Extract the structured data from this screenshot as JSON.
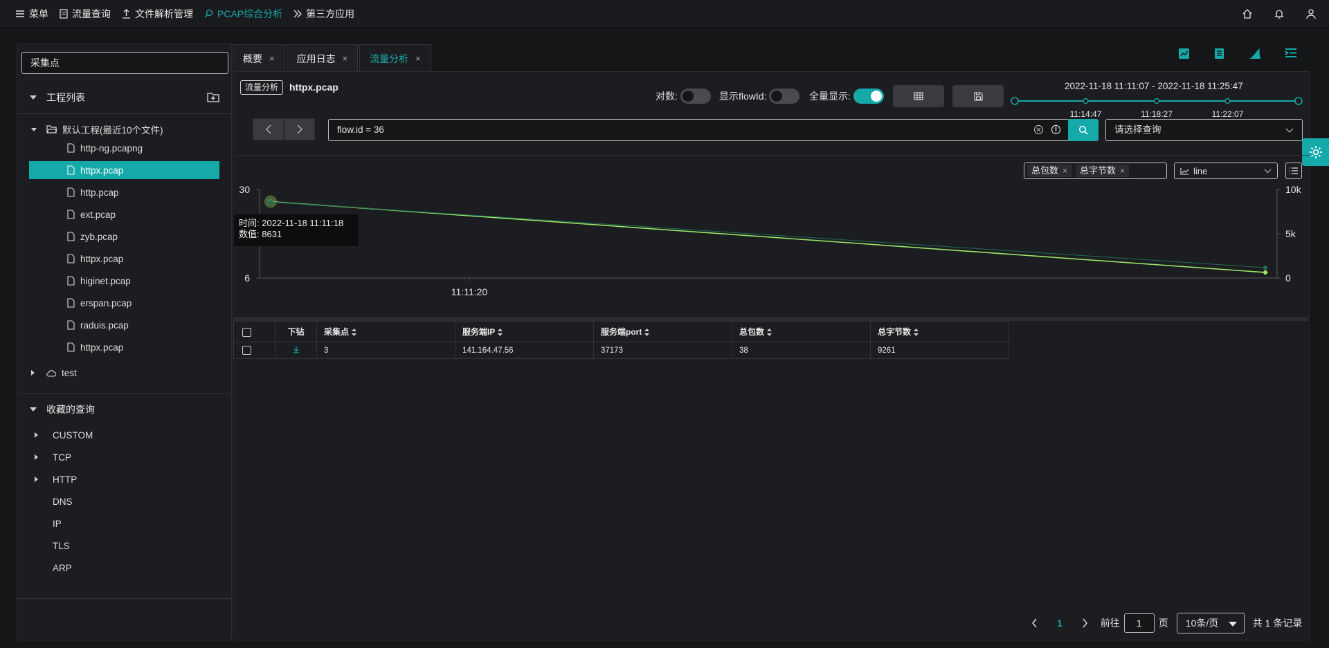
{
  "nav": {
    "menu": "菜单",
    "flow_query": "流量查询",
    "file_parse": "文件解析管理",
    "pcap_analysis": "PCAP综合分析",
    "third_party": "第三方应用"
  },
  "left": {
    "search_placeholder": "采集点",
    "project_list": "工程列表",
    "default_project": "默认工程(最近10个文件)",
    "files": [
      "http-ng.pcapng",
      "httpx.pcap",
      "http.pcap",
      "ext.pcap",
      "zyb.pcap",
      "httpx.pcap",
      "higinet.pcap",
      "erspan.pcap",
      "raduis.pcap",
      "httpx.pcap"
    ],
    "selected_file_index": 1,
    "test_project": "test",
    "favorites": "收藏的查询",
    "queries": [
      {
        "label": "CUSTOM",
        "expandable": true
      },
      {
        "label": "TCP",
        "expandable": true
      },
      {
        "label": "HTTP",
        "expandable": true
      },
      {
        "label": "DNS",
        "expandable": false
      },
      {
        "label": "IP",
        "expandable": false
      },
      {
        "label": "TLS",
        "expandable": false
      },
      {
        "label": "ARP",
        "expandable": false
      }
    ]
  },
  "tabs": [
    {
      "label": "概要",
      "active": false
    },
    {
      "label": "应用日志",
      "active": false
    },
    {
      "label": "流量分析",
      "active": true
    }
  ],
  "header": {
    "badge": "流量分析",
    "filename": "httpx.pcap",
    "log_label": "对数:",
    "log_on": false,
    "flowid_label": "显示flowId:",
    "flowid_on": false,
    "full_label": "全量显示:",
    "full_on": true,
    "time_range": "2022-11-18 11:11:07 - 2022-11-18 11:25:47",
    "timeline_ticks": [
      "11:14:47",
      "11:18:27",
      "11:22:07"
    ]
  },
  "query": {
    "value": "flow.id = 36",
    "select_placeholder": "请选择查询"
  },
  "chart_controls": {
    "metrics": [
      "总包数",
      "总字节数"
    ],
    "chart_type": "line"
  },
  "chart_data": {
    "type": "line",
    "x": [
      "2022-11-18 11:11:18",
      "2022-11-18 11:25:47"
    ],
    "x_tick_labels": [
      "11:11:20"
    ],
    "y_left_ticks": [
      "30",
      "6"
    ],
    "y_right_ticks": [
      "10k",
      "5k",
      "0"
    ],
    "ylim_left": [
      6,
      30
    ],
    "ylim_right": [
      0,
      10000
    ],
    "series": [
      {
        "axis": "right",
        "values": [
          8631,
          630
        ],
        "color": "#9be36a"
      },
      {
        "axis": "left",
        "values": [
          28,
          9
        ],
        "color": "#1f6b55"
      }
    ],
    "tooltip": {
      "time_label": "时间:",
      "time": "2022-11-18 11:11:18",
      "value_label": "数值:",
      "value": "8631"
    },
    "grid": false
  },
  "table": {
    "columns": [
      "",
      "下钻",
      "采集点",
      "服务端IP",
      "服务端port",
      "总包数",
      "总字节数"
    ],
    "rows": [
      [
        "",
        "",
        "3",
        "141.164.47.56",
        "37173",
        "38",
        "9261"
      ]
    ]
  },
  "pager": {
    "current": "1",
    "goto_label": "前往",
    "goto_value": "1",
    "page_unit": "页",
    "page_size": "10条/页",
    "total": "共 1 条记录"
  },
  "colors": {
    "accent": "#16a9a9",
    "line": "#9be36a"
  }
}
